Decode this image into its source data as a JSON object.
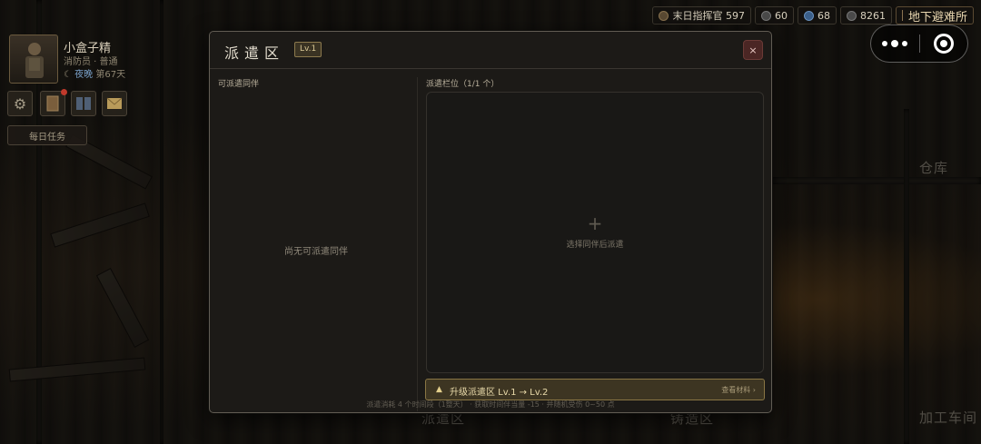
{
  "hud": {
    "resources": [
      {
        "label": "末日指挥官 597",
        "icon": "commander-icon"
      },
      {
        "label": "60",
        "icon": "coin-icon"
      },
      {
        "label": "68",
        "icon": "gem-icon"
      },
      {
        "label": "8261",
        "icon": "scrap-icon"
      }
    ],
    "shelter_label": "地下避难所"
  },
  "player": {
    "name": "小盒子精",
    "role": "消防员 · 普通",
    "status_night": "夜晚",
    "status_day": "第67天"
  },
  "sidebar": {
    "daily_task": "每日任务"
  },
  "scene_labels": {
    "warehouse": "仓库",
    "dispatch": "派遣区",
    "forge": "铸造区",
    "workshop": "加工车间"
  },
  "modal": {
    "title": "派遣区",
    "level": "Lv.1",
    "close_glyph": "×",
    "left": {
      "label": "可派遣同伴",
      "empty": "尚无可派遣同伴"
    },
    "right": {
      "label": "派遣栏位（1/1 个）",
      "plus": "+",
      "hint": "选择同伴后派遣"
    },
    "upgrade": {
      "arrow": "▲",
      "label": "升级派遣区   Lv.1 → Lv.2",
      "view": "查看材料 ›"
    },
    "footer": "派遣消耗 4 个时间段（1整天） · 获取时间伴当量 -15 · 并随机受伤 0~50 点"
  },
  "colors": {
    "accent_gold": "#8a7644",
    "close_red": "#4b2624",
    "night_blue": "#7aa0c8"
  }
}
